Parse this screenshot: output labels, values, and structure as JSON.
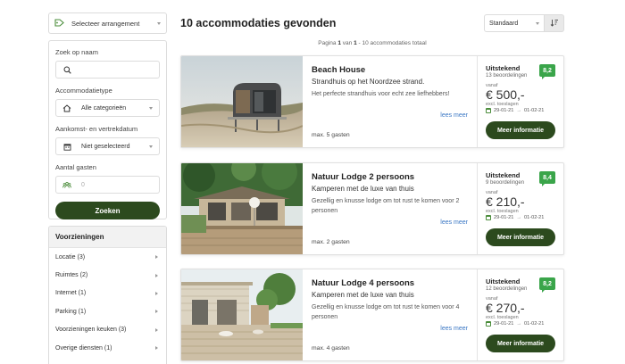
{
  "sidebar": {
    "arrangement_label": "Selecteer arrangement",
    "search_name_label": "Zoek op naam",
    "accommodation_type_label": "Accommodatietype",
    "accommodation_type_value": "Alle categorieën",
    "dates_label": "Aankomst- en vertrekdatum",
    "dates_value": "Niet geselecteerd",
    "guests_label": "Aantal gasten",
    "guests_placeholder": "0",
    "search_button": "Zoeken",
    "facilities_title": "Voorzieningen",
    "facilities": [
      {
        "label": "Locatie (3)"
      },
      {
        "label": "Ruimtes (2)"
      },
      {
        "label": "Internet (1)"
      },
      {
        "label": "Parking (1)"
      },
      {
        "label": "Voorzieningen keuken (3)"
      },
      {
        "label": "Overige diensten (1)"
      }
    ]
  },
  "main": {
    "heading": "10 accommodaties gevonden",
    "sort_value": "Standaard",
    "pagination": {
      "prefix": "Pagina",
      "page": "1",
      "of": "van",
      "total_pages": "1",
      "suffix": "- 10 accommodaties totaal"
    },
    "read_more": "lees meer",
    "more_info": "Meer informatie",
    "from_label": "vanaf",
    "price_note": "excl. toeslagen",
    "cards": [
      {
        "title": "Beach House",
        "subtitle": "Strandhuis op het Noordzee strand.",
        "description": "Het perfecte strandhuis voor echt zee liefhebbers!",
        "guests": "max. 5 gasten",
        "rating_word": "Uitstekend",
        "rating_count": "13 beoordelingen",
        "score": "8,2",
        "price": "€ 500,-",
        "date_from": "29-01-21",
        "date_to": "01-02-21"
      },
      {
        "title": "Natuur Lodge 2 persoons",
        "subtitle": "Kamperen met de luxe van thuis",
        "description": "Gezellig en knusse lodge om tot rust te komen voor 2 personen",
        "guests": "max. 2 gasten",
        "rating_word": "Uitstekend",
        "rating_count": "9 beoordelingen",
        "score": "8,4",
        "price": "€ 210,-",
        "date_from": "29-01-21",
        "date_to": "01-02-21"
      },
      {
        "title": "Natuur Lodge 4 persoons",
        "subtitle": "Kamperen met de luxe van thuis",
        "description": "Gezellig en knusse lodge om tot rust te komen voor 4 personen",
        "guests": "max. 4 gasten",
        "rating_word": "Uitstekend",
        "rating_count": "12 beoordelingen",
        "score": "8,2",
        "price": "€ 270,-",
        "date_from": "29-01-21",
        "date_to": "01-02-21"
      }
    ]
  },
  "colors": {
    "primary": "#2c4a1e",
    "score": "#3aa54a",
    "link": "#3a77c4"
  }
}
